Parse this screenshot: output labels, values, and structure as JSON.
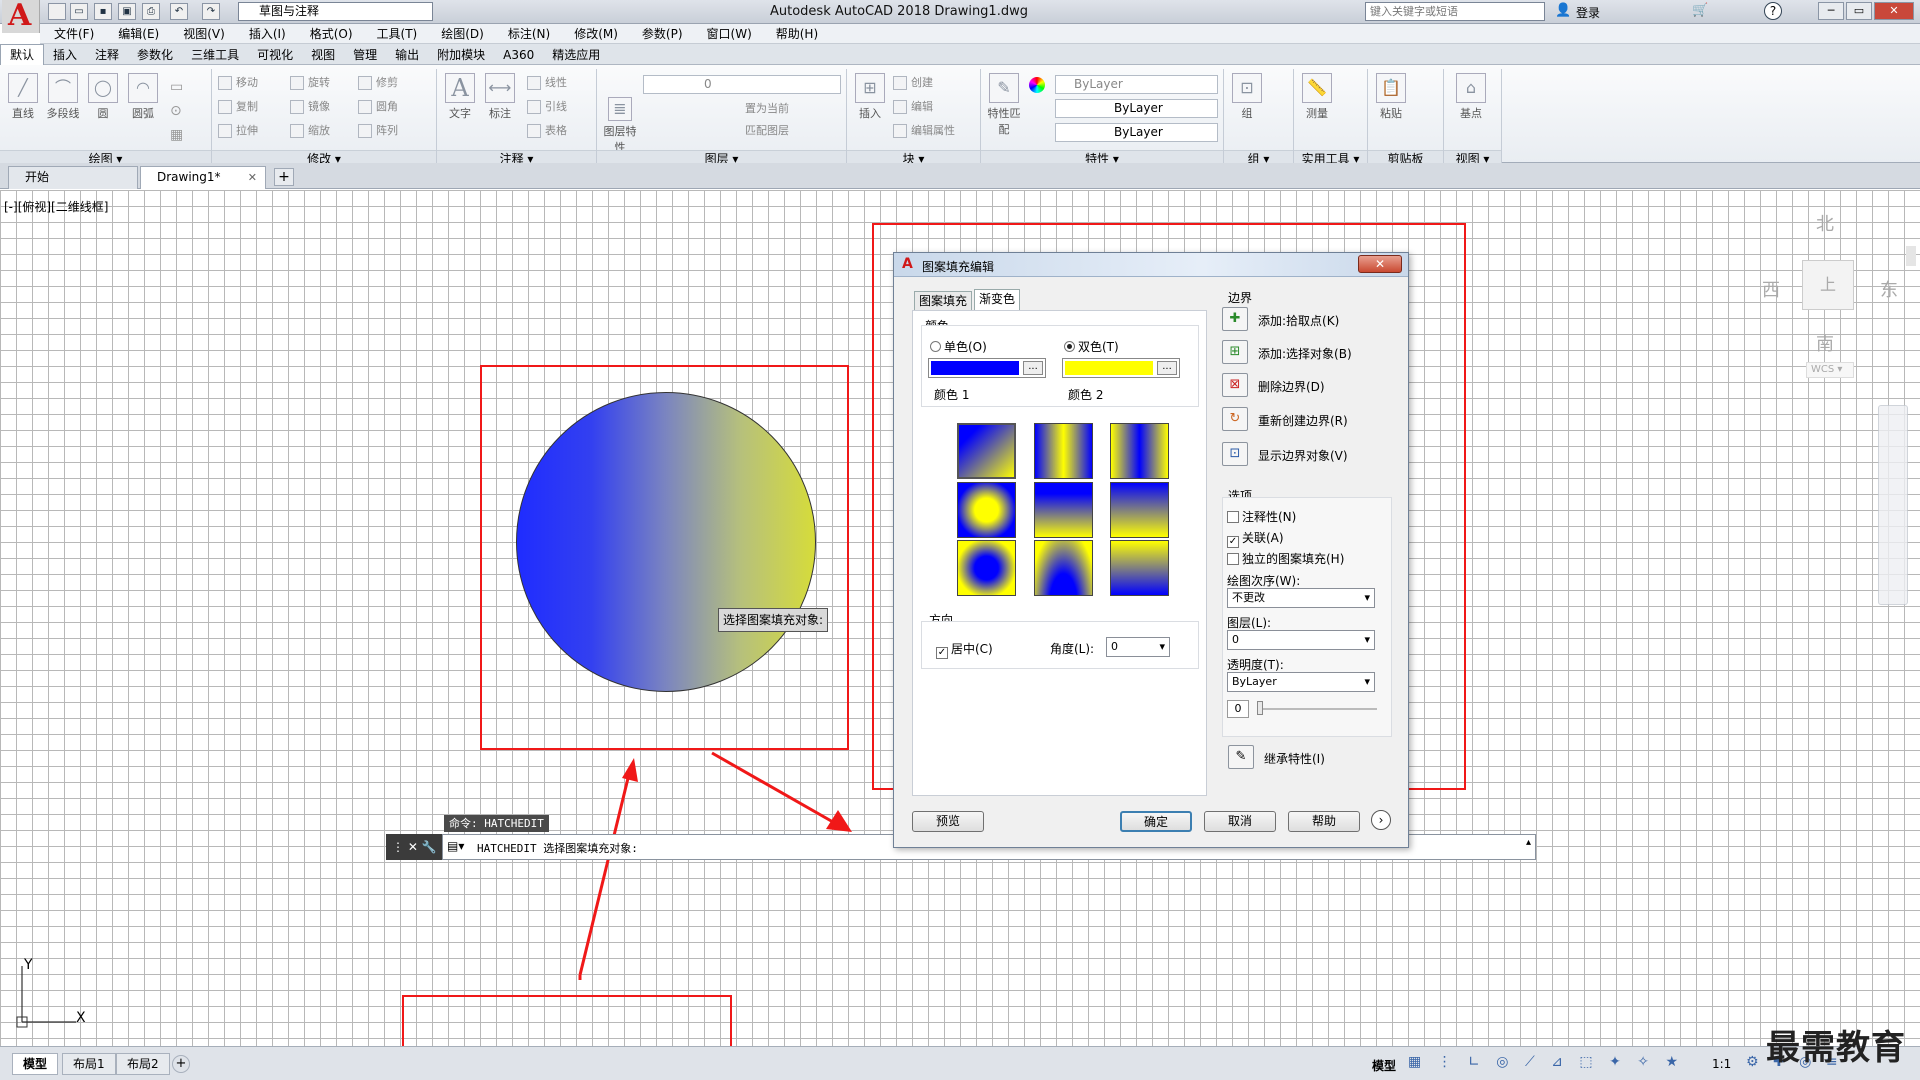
{
  "app": {
    "logo_letter": "A",
    "title": "Autodesk AutoCAD 2018    Drawing1.dwg",
    "workspace": "草图与注释",
    "search_placeholder": "键入关键字或短语",
    "login": "登录",
    "help": "?"
  },
  "menu": [
    "文件(F)",
    "编辑(E)",
    "视图(V)",
    "插入(I)",
    "格式(O)",
    "工具(T)",
    "绘图(D)",
    "标注(N)",
    "修改(M)",
    "参数(P)",
    "窗口(W)",
    "帮助(H)"
  ],
  "ribbon_tabs": [
    "默认",
    "插入",
    "注释",
    "参数化",
    "三维工具",
    "可视化",
    "视图",
    "管理",
    "输出",
    "附加模块",
    "A360",
    "精选应用"
  ],
  "ribbon": {
    "draw": {
      "items": [
        "直线",
        "多段线",
        "圆",
        "圆弧"
      ],
      "footer": "绘图 ▾"
    },
    "modify": {
      "items": [
        "移动",
        "旋转",
        "修剪",
        "复制",
        "镜像",
        "圆角",
        "拉伸",
        "缩放",
        "阵列"
      ],
      "footer": "修改 ▾"
    },
    "annotation": {
      "items": [
        "文字",
        "标注",
        "线性",
        "引线",
        "表格"
      ],
      "footer": "注释 ▾"
    },
    "layers": {
      "items": [
        "图层特性",
        "置为当前",
        "匹配图层"
      ],
      "current": "0",
      "footer": "图层 ▾"
    },
    "block": {
      "items": [
        "插入",
        "创建",
        "编辑",
        "编辑属性"
      ],
      "footer": "块 ▾"
    },
    "properties": {
      "items": [
        "特性匹配"
      ],
      "color": "ByLayer",
      "linetype": "ByLayer",
      "lineweight": "ByLayer",
      "footer": "特性 ▾"
    },
    "groups": {
      "items": [
        "组"
      ],
      "footer": "组 ▾"
    },
    "utilities": {
      "items": [
        "测量"
      ],
      "footer": "实用工具 ▾"
    },
    "clipboard": {
      "items": [
        "粘贴"
      ],
      "footer": "剪贴板"
    },
    "view": {
      "items": [
        "基点"
      ],
      "footer": "视图 ▾"
    }
  },
  "doc_tabs": [
    "开始",
    "Drawing1*"
  ],
  "viewport_label": "[-][俯视][二维线框]",
  "tooltip": "选择图案填充对象:",
  "viewcube": {
    "north": "北",
    "south": "南",
    "east": "东",
    "west": "西",
    "face": "上",
    "wcs": "WCS"
  },
  "ucs": {
    "x": "X",
    "y": "Y"
  },
  "command": {
    "history": "命令: HATCHEDIT",
    "prompt": "HATCHEDIT 选择图案填充对象:"
  },
  "status": {
    "tabs": [
      "模型",
      "布局1",
      "布局2"
    ],
    "model": "模型",
    "scale": "1:1"
  },
  "watermark": "最需教育",
  "dialog": {
    "title": "图案填充编辑",
    "close": "✕",
    "tabs": [
      "图案填充",
      "渐变色"
    ],
    "color_section": "颜色",
    "one_color": "单色(O)",
    "two_color": "双色(T)",
    "color1_label": "颜色 1",
    "color2_label": "颜色 2",
    "color1": "#0000ff",
    "color2": "#ffff00",
    "dots": "...",
    "orientation_section": "方向",
    "centered": "居中(C)",
    "angle_label": "角度(L):",
    "angle": "0",
    "boundaries_section": "边界",
    "boundary_buttons": [
      "添加:拾取点(K)",
      "添加:选择对象(B)",
      "删除边界(D)",
      "重新创建边界(R)",
      "显示边界对象(V)"
    ],
    "options_section": "选项",
    "annotative": "注释性(N)",
    "associative": "关联(A)",
    "separate": "独立的图案填充(H)",
    "draw_order_label": "绘图次序(W):",
    "draw_order": "不更改",
    "layer_label": "图层(L):",
    "layer": "0",
    "transparency_label": "透明度(T):",
    "transparency": "ByLayer",
    "transparency_value": "0",
    "inherit": "继承特性(I)",
    "preview": "预览",
    "ok": "确定",
    "cancel": "取消",
    "help": "帮助"
  },
  "colors": {
    "highlight_red": "#f01818"
  }
}
